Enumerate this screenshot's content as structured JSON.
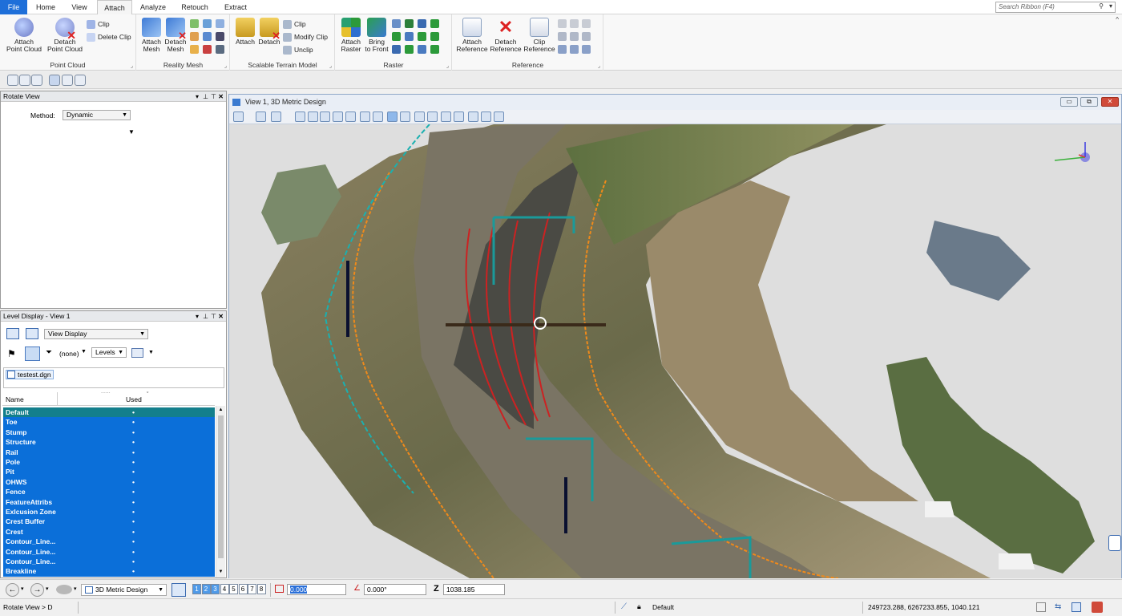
{
  "tabs": {
    "file": "File",
    "home": "Home",
    "view": "View",
    "attach": "Attach",
    "analyze": "Analyze",
    "retouch": "Retouch",
    "extract": "Extract"
  },
  "search": {
    "placeholder": "Search Ribbon (F4)"
  },
  "ribbon": {
    "point_cloud": {
      "label": "Point Cloud",
      "attach": "Attach\nPoint Cloud",
      "detach": "Detach\nPoint Cloud",
      "clip": "Clip",
      "delete_clip": "Delete Clip"
    },
    "reality_mesh": {
      "label": "Reality Mesh",
      "attach": "Attach\nMesh",
      "detach": "Detach\nMesh"
    },
    "terrain": {
      "label": "Scalable Terrain Model",
      "attach": "Attach",
      "detach": "Detach",
      "clip": "Clip",
      "modify_clip": "Modify Clip",
      "unclip": "Unclip"
    },
    "raster": {
      "label": "Raster",
      "attach": "Attach\nRaster",
      "bring_front": "Bring\nto Front"
    },
    "reference": {
      "label": "Reference",
      "attach": "Attach\nReference",
      "detach": "Detach\nReference",
      "clip": "Clip\nReference"
    }
  },
  "rotate_panel": {
    "title": "Rotate View",
    "method_label": "Method:",
    "method_value": "Dynamic"
  },
  "level_panel": {
    "title": "Level Display - View 1",
    "view_display": "View Display",
    "filter": "(none)",
    "levels": "Levels",
    "file": "testest.dgn",
    "col_name": "Name",
    "col_used": "Used",
    "levels_list": [
      "Default",
      "Toe",
      "Stump",
      "Structure",
      "Rail",
      "Pole",
      "Pit",
      "OHWS",
      "Fence",
      "FeatureAttribs",
      "Exlcusion Zone",
      "Crest Buffer",
      "Crest",
      "Contour_Line...",
      "Contour_Line...",
      "Contour_Line...",
      "Breakline"
    ],
    "used_mark": "•"
  },
  "view": {
    "title": "View 1, 3D Metric Design",
    "min": "▭",
    "max": "⧉",
    "close": "✕"
  },
  "bottom": {
    "model": "3D Metric Design",
    "views": [
      "1",
      "2",
      "3",
      "4",
      "5",
      "6",
      "7",
      "8"
    ],
    "x_value": "0.000",
    "angle_value": "0.000°",
    "z_label": "Z",
    "z_value": "1038.185"
  },
  "status": {
    "prompt": "Rotate View > D",
    "level": "Default",
    "coords": "249723.288, 6267233.855, 1040.121"
  },
  "colors": {
    "accent": "#1e6fd9",
    "level_selected": "#0b6fd9",
    "level_first": "#137f8c"
  }
}
